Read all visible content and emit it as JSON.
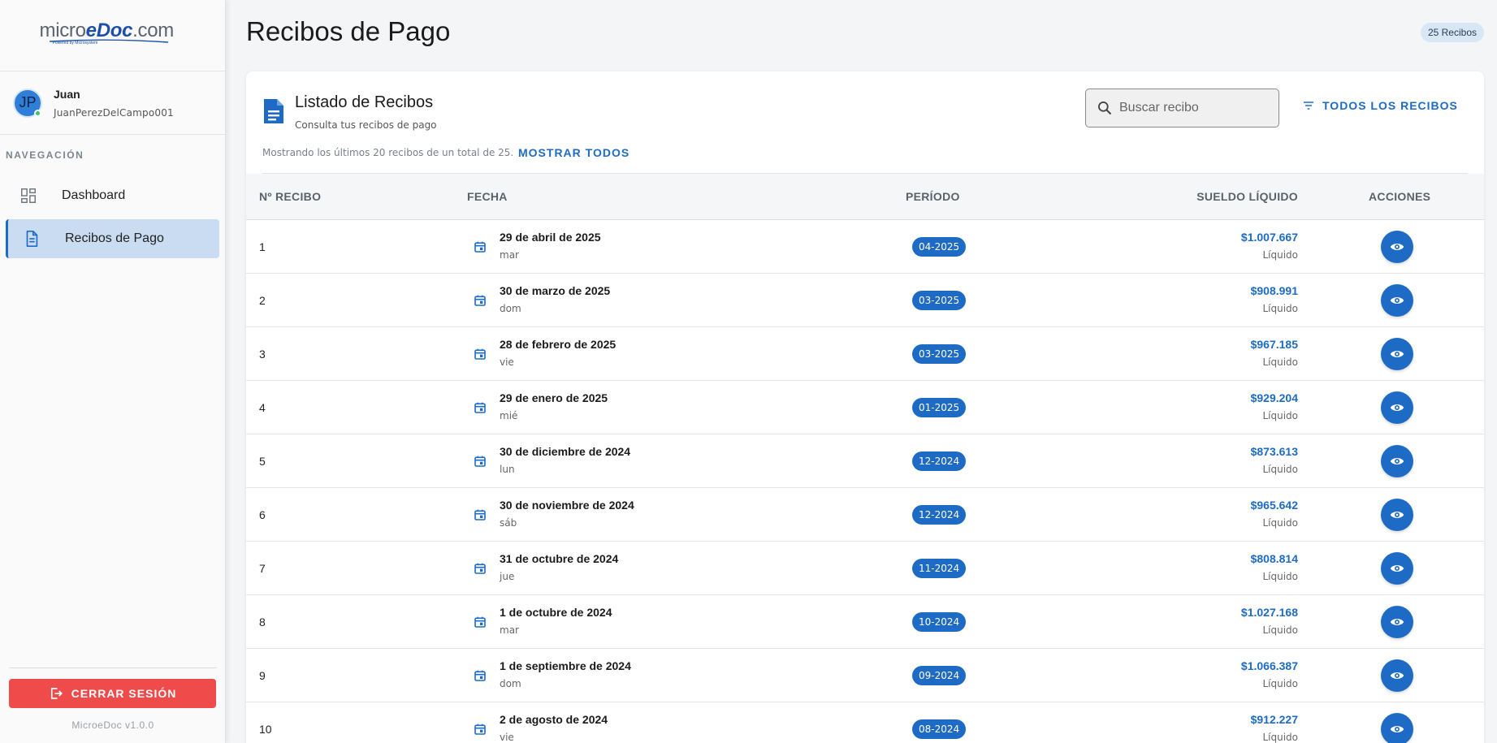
{
  "brand": {
    "logo_main_prefix": "micro",
    "logo_main_accent": "eDoc",
    "logo_main_suffix": ".com",
    "logo_sub": "Powered by Microsystem"
  },
  "user": {
    "initials": "JP",
    "name": "Juan",
    "username": "JuanPerezDelCampo001"
  },
  "nav": {
    "header": "NAVEGACIÓN",
    "items": [
      {
        "label": "Dashboard",
        "icon": "dashboard-icon",
        "active": false
      },
      {
        "label": "Recibos de Pago",
        "icon": "document-icon",
        "active": true
      }
    ]
  },
  "logout_label": "CERRAR SESIÓN",
  "version": "MicroeDoc v1.0.0",
  "page": {
    "title": "Recibos de Pago",
    "count_badge": "25 Recibos"
  },
  "card": {
    "title": "Listado de Recibos",
    "subtitle": "Consulta tus recibos de pago",
    "search_placeholder": "Buscar recibo",
    "filter_label": "TODOS LOS RECIBOS",
    "showing_text": "Mostrando los últimos 20 recibos de un total de 25.",
    "show_all_label": "MOSTRAR TODOS"
  },
  "table": {
    "headers": {
      "num": "Nº RECIBO",
      "fecha": "FECHA",
      "periodo": "PERÍODO",
      "sueldo": "SUELDO LÍQUIDO",
      "acciones": "ACCIONES"
    },
    "rows": [
      {
        "num": "1",
        "date": "29 de abril de 2025",
        "day": "mar",
        "period": "04-2025",
        "amount": "$1.007.667",
        "amount_label": "Líquido"
      },
      {
        "num": "2",
        "date": "30 de marzo de 2025",
        "day": "dom",
        "period": "03-2025",
        "amount": "$908.991",
        "amount_label": "Líquido"
      },
      {
        "num": "3",
        "date": "28 de febrero de 2025",
        "day": "vie",
        "period": "03-2025",
        "amount": "$967.185",
        "amount_label": "Líquido"
      },
      {
        "num": "4",
        "date": "29 de enero de 2025",
        "day": "mié",
        "period": "01-2025",
        "amount": "$929.204",
        "amount_label": "Líquido"
      },
      {
        "num": "5",
        "date": "30 de diciembre de 2024",
        "day": "lun",
        "period": "12-2024",
        "amount": "$873.613",
        "amount_label": "Líquido"
      },
      {
        "num": "6",
        "date": "30 de noviembre de 2024",
        "day": "sáb",
        "period": "12-2024",
        "amount": "$965.642",
        "amount_label": "Líquido"
      },
      {
        "num": "7",
        "date": "31 de octubre de 2024",
        "day": "jue",
        "period": "11-2024",
        "amount": "$808.814",
        "amount_label": "Líquido"
      },
      {
        "num": "8",
        "date": "1 de octubre de 2024",
        "day": "mar",
        "period": "10-2024",
        "amount": "$1.027.168",
        "amount_label": "Líquido"
      },
      {
        "num": "9",
        "date": "1 de septiembre de 2024",
        "day": "dom",
        "period": "09-2024",
        "amount": "$1.066.387",
        "amount_label": "Líquido"
      },
      {
        "num": "10",
        "date": "2 de agosto de 2024",
        "day": "vie",
        "period": "08-2024",
        "amount": "$912.227",
        "amount_label": "Líquido"
      }
    ]
  },
  "colors": {
    "accent": "#1e6bc5",
    "logout": "#ef4b4b",
    "active_nav_bg": "#c9dcf1"
  }
}
